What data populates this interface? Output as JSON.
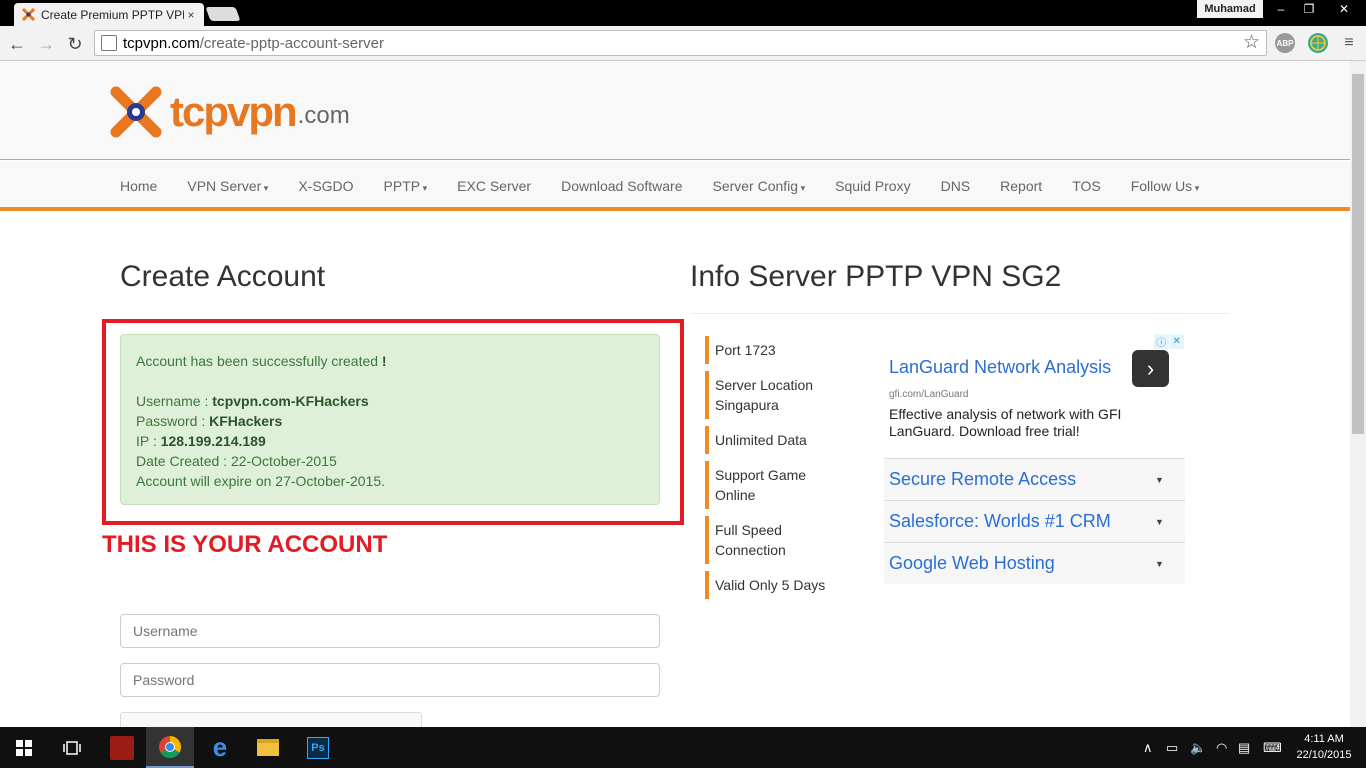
{
  "browser": {
    "tab_title": "Create Premium PPTP VPN",
    "tab_close": "×",
    "user": "Muhamad",
    "url_domain": "tcpvpn.com",
    "url_path": "/create-pptp-account-server",
    "extensions": [
      "ABP"
    ]
  },
  "site": {
    "logo_word": "tcpvpn",
    "logo_suffix": ".com",
    "nav": [
      {
        "label": "Home",
        "dropdown": false
      },
      {
        "label": "VPN Server",
        "dropdown": true
      },
      {
        "label": "X-SGDO",
        "dropdown": false
      },
      {
        "label": "PPTP",
        "dropdown": true
      },
      {
        "label": "EXC Server",
        "dropdown": false
      },
      {
        "label": "Download Software",
        "dropdown": false
      },
      {
        "label": "Server Config",
        "dropdown": true
      },
      {
        "label": "Squid Proxy",
        "dropdown": false
      },
      {
        "label": "DNS",
        "dropdown": false
      },
      {
        "label": "Report",
        "dropdown": false
      },
      {
        "label": "TOS",
        "dropdown": false
      },
      {
        "label": "Follow Us",
        "dropdown": true
      }
    ]
  },
  "create": {
    "title": "Create Account",
    "success_msg": "Account has been successfully created",
    "success_bang": "!",
    "username_label": "Username : ",
    "username_value": "tcpvpn.com-KFHackers",
    "password_label": "Password : ",
    "password_value": "KFHackers",
    "ip_label": "IP : ",
    "ip_value": "128.199.214.189",
    "date_created": "Date Created : 22-October-2015",
    "expire": "Account will expire on 27-October-2015.",
    "annotation": "THIS IS YOUR ACCOUNT",
    "username_placeholder": "Username",
    "password_placeholder": "Password"
  },
  "info": {
    "title": "Info Server PPTP VPN SG2",
    "items": [
      [
        "Port 1723"
      ],
      [
        "Server Location",
        "Singapura"
      ],
      [
        "Unlimited Data"
      ],
      [
        "Support Game",
        "Online"
      ],
      [
        "Full Speed",
        "Connection"
      ],
      [
        "Valid Only 5 Days"
      ]
    ]
  },
  "ad": {
    "headline": "LanGuard Network Analysis",
    "url": "gfi.com/LanGuard",
    "desc": "Effective analysis of network with GFI LanGuard. Download free trial!",
    "rows": [
      "Secure Remote Access",
      "Salesforce: Worlds #1 CRM",
      "Google Web Hosting"
    ]
  },
  "taskbar": {
    "time": "4:11 AM",
    "date": "22/10/2015"
  },
  "colors": {
    "accent": "#f08a24",
    "annotation_red": "#e21b24",
    "alert_bg": "#dff0d8",
    "alert_text": "#3c763d"
  }
}
